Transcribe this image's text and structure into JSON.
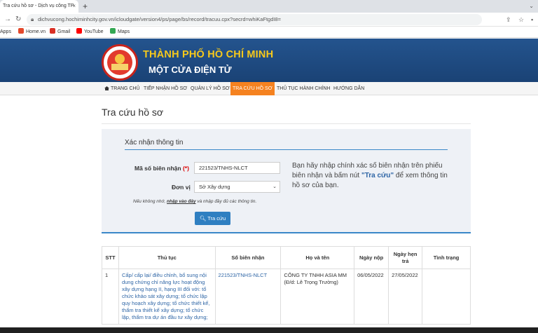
{
  "browser": {
    "tab_title": "Tra cứu hồ sơ - Dịch vụ công TP",
    "tab_close": "×",
    "new_tab": "+",
    "url": "dichvucong.hochiminhcity.gov.vn/icloudgate/version4/ps/page/bs/record/tracuu.cpx?secrd=whiKaFtgdI8=",
    "bookmarks": [
      {
        "label": "Apps",
        "icon": "apps-icon",
        "color": "#4285f4"
      },
      {
        "label": "Home.vn",
        "icon": "home-vn-icon",
        "color": "#e4492c"
      },
      {
        "label": "Gmail",
        "icon": "gmail-icon",
        "color": "#d93025"
      },
      {
        "label": "YouTube",
        "icon": "youtube-icon",
        "color": "#ff0000"
      },
      {
        "label": "Maps",
        "icon": "maps-icon",
        "color": "#34a853"
      }
    ]
  },
  "site": {
    "title_line1": "THÀNH PHỐ HỒ CHÍ MINH",
    "title_line2": "MỘT CỬA ĐIỆN TỬ"
  },
  "menu": [
    "TRANG CHỦ",
    "TIẾP NHẬN HỒ SƠ",
    "QUẢN LÝ HỒ SƠ",
    "TRA CỨU HỒ SƠ",
    "THỦ TỤC HÀNH CHÍNH",
    "HƯỚNG DẪN"
  ],
  "page": {
    "title": "Tra cứu hồ sơ",
    "form_title": "Xác nhận thông tin",
    "receipt_label": "Mã số biên nhận",
    "receipt_required": "(*)",
    "receipt_value": "221523/TNHS-NLCT",
    "unit_label": "Đơn vị",
    "unit_value": "Sở Xây dựng",
    "note_prefix": "Nếu không nhớ, ",
    "note_link": "nhập vào đây",
    "note_suffix": " và nhập đầy đủ các thông tin.",
    "search_button": "Tra cứu",
    "hint_part1": "Bạn hãy nhập chính xác số biên nhận trên phiếu biên nhận và bấm nút ",
    "hint_bold": "\"Tra cứu\"",
    "hint_part2": " để xem thông tin hồ sơ của bạn."
  },
  "results": {
    "headers": [
      "STT",
      "Thủ tục",
      "Số biên nhận",
      "Họ và tên",
      "Ngày nộp",
      "Ngày hẹn trả",
      "Tình trạng"
    ],
    "rows": [
      {
        "stt": "1",
        "procedure": "Cấp/ cấp lại/ điều chỉnh, bổ sung nội dung chứng chỉ năng lực hoạt động xây dựng hạng II, hạng III đối với: tổ chức khảo sát xây dựng; tổ chức lập quy hoạch xây dựng; tổ chức thiết kế, thẩm tra thiết kế xây dựng; tổ chức lập, thẩm tra dự án đầu tư xây dựng;",
        "receipt": "221523/TNHS-NLCT",
        "name": "CÔNG TY TNHH ASIA MM (Đ/d: Lê Trọng Trường)",
        "submitted": "06/05/2022",
        "due": "27/05/2022",
        "status": ""
      }
    ]
  }
}
